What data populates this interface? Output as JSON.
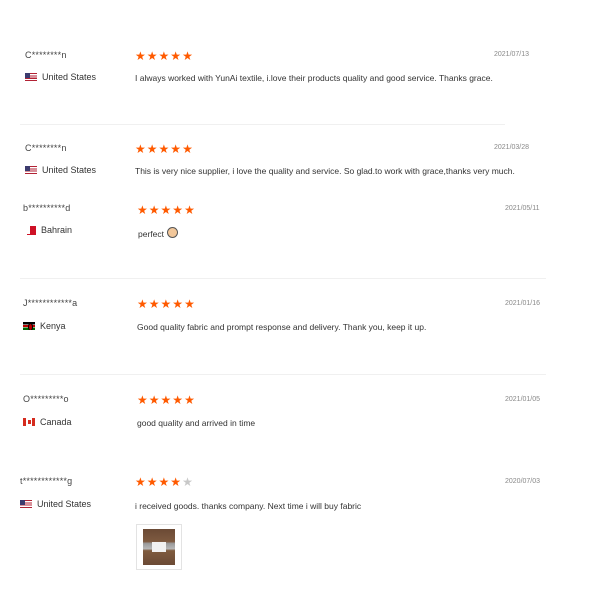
{
  "reviews": [
    {
      "name": "C********n",
      "country": "United States",
      "flag_icon": "us-flag-icon",
      "rating": 5,
      "date": "2021/07/13",
      "text": "I always worked with YunAi textile, i.love their products quality and good service. Thanks grace."
    },
    {
      "name": "C********n",
      "country": "United States",
      "flag_icon": "us-flag-icon",
      "rating": 5,
      "date": "2021/03/28",
      "text": "This is very nice supplier, i love the quality and service. So glad.to work with grace,thanks very much."
    },
    {
      "name": "b**********d",
      "country": "Bahrain",
      "flag_icon": "bahrain-flag-icon",
      "rating": 5,
      "date": "2021/05/11",
      "text": "perfect",
      "emoji": "thumbs-up-emoji-icon"
    },
    {
      "name": "J************a",
      "country": "Kenya",
      "flag_icon": "kenya-flag-icon",
      "rating": 5,
      "date": "2021/01/16",
      "text": "Good quality fabric and prompt response and delivery. Thank you, keep it up."
    },
    {
      "name": "O*********o",
      "country": "Canada",
      "flag_icon": "canada-flag-icon",
      "rating": 5,
      "date": "2021/01/05",
      "text": "good quality and arrived in time"
    },
    {
      "name": "t************g",
      "country": "United States",
      "flag_icon": "us-flag-icon",
      "rating": 4,
      "date": "2020/07/03",
      "text": "i received goods. thanks company. Next time i will buy fabric",
      "attachment": "review-photo-thumbnail"
    }
  ],
  "colors": {
    "star_on": "#ff5a00",
    "star_off": "#c8c8c8",
    "date_text": "#888888",
    "divider": "#f0f0f0"
  }
}
